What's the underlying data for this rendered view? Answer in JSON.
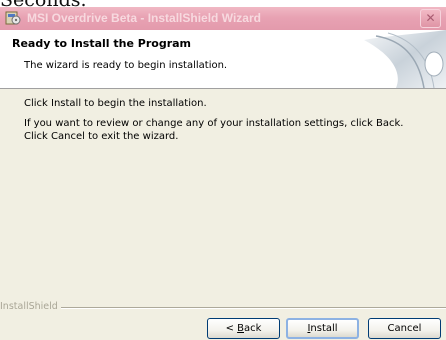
{
  "behind_window_text": "Seconds.",
  "window": {
    "title": "MSI Overdrive Beta - InstallShield Wizard",
    "close_glyph": "✕"
  },
  "header": {
    "title": "Ready to Install the Program",
    "subtitle": "The wizard is ready to begin installation."
  },
  "body": {
    "line1": "Click Install to begin the installation.",
    "line2": "If you want to review or change any of your installation settings, click Back. Click Cancel to exit the wizard."
  },
  "footer": {
    "brand": "InstallShield",
    "back_mnemonic": "B",
    "back_rest": "ack",
    "back_prefix": "< ",
    "install_mnemonic": "I",
    "install_rest": "nstall",
    "cancel_label": "Cancel"
  },
  "icons": {
    "title_icon": "installer-icon",
    "header_graphic": "cd-disc-graphic",
    "close": "close-icon"
  },
  "colors": {
    "titlebar": "#e8a2b3",
    "window_bg": "#f1efe2",
    "button_border": "#003c74",
    "default_button_focus": "#8db2e3"
  }
}
